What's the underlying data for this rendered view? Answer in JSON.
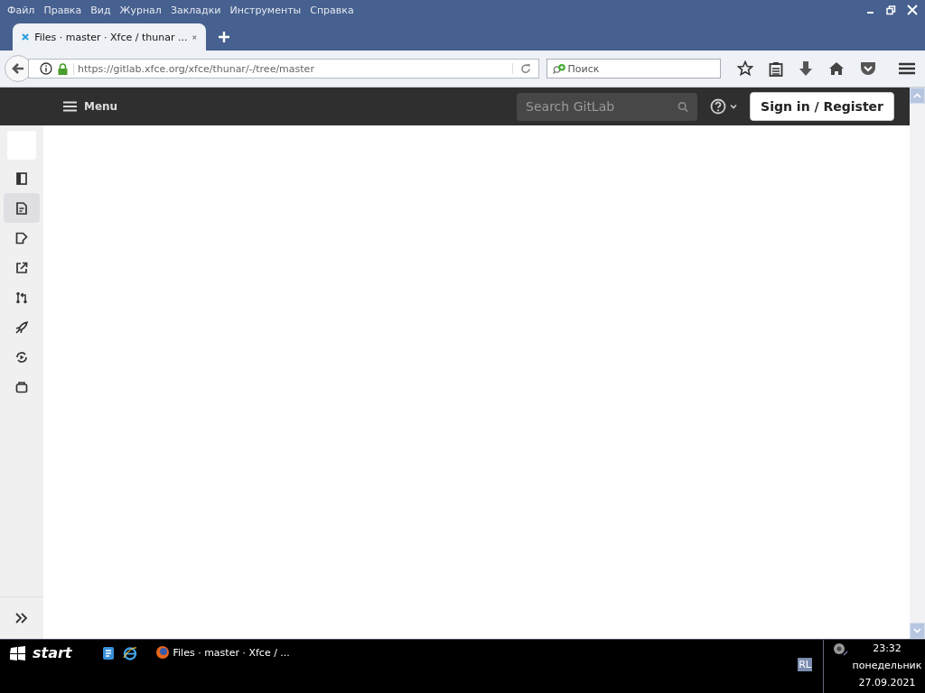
{
  "menu_bar": {
    "items": [
      "Файл",
      "Правка",
      "Вид",
      "Журнал",
      "Закладки",
      "Инструменты",
      "Справка"
    ]
  },
  "tabs": [
    {
      "title": "Files · master · Xfce / thunar ...",
      "selected": true
    }
  ],
  "nav_bar": {
    "url": "https://gitlab.xfce.org/xfce/thunar/-/tree/master",
    "search": {
      "placeholder": "Поиск"
    }
  },
  "gitlab_header": {
    "menu": "Menu",
    "search": {
      "placeholder": "Search GitLab"
    },
    "sign_in": "Sign in / Register"
  },
  "sidebar": {
    "items": [
      {
        "selected": false
      },
      {
        "selected": true
      },
      {
        "selected": false
      },
      {
        "selected": false
      },
      {
        "selected": false
      },
      {
        "selected": false
      },
      {
        "selected": false
      },
      {
        "selected": false
      }
    ]
  },
  "taskbar": {
    "start": "start",
    "task": "Files · master · Xfce / ...",
    "language": "RL",
    "time": "23:32",
    "day": "понедельник",
    "date": "27.09.2021"
  }
}
